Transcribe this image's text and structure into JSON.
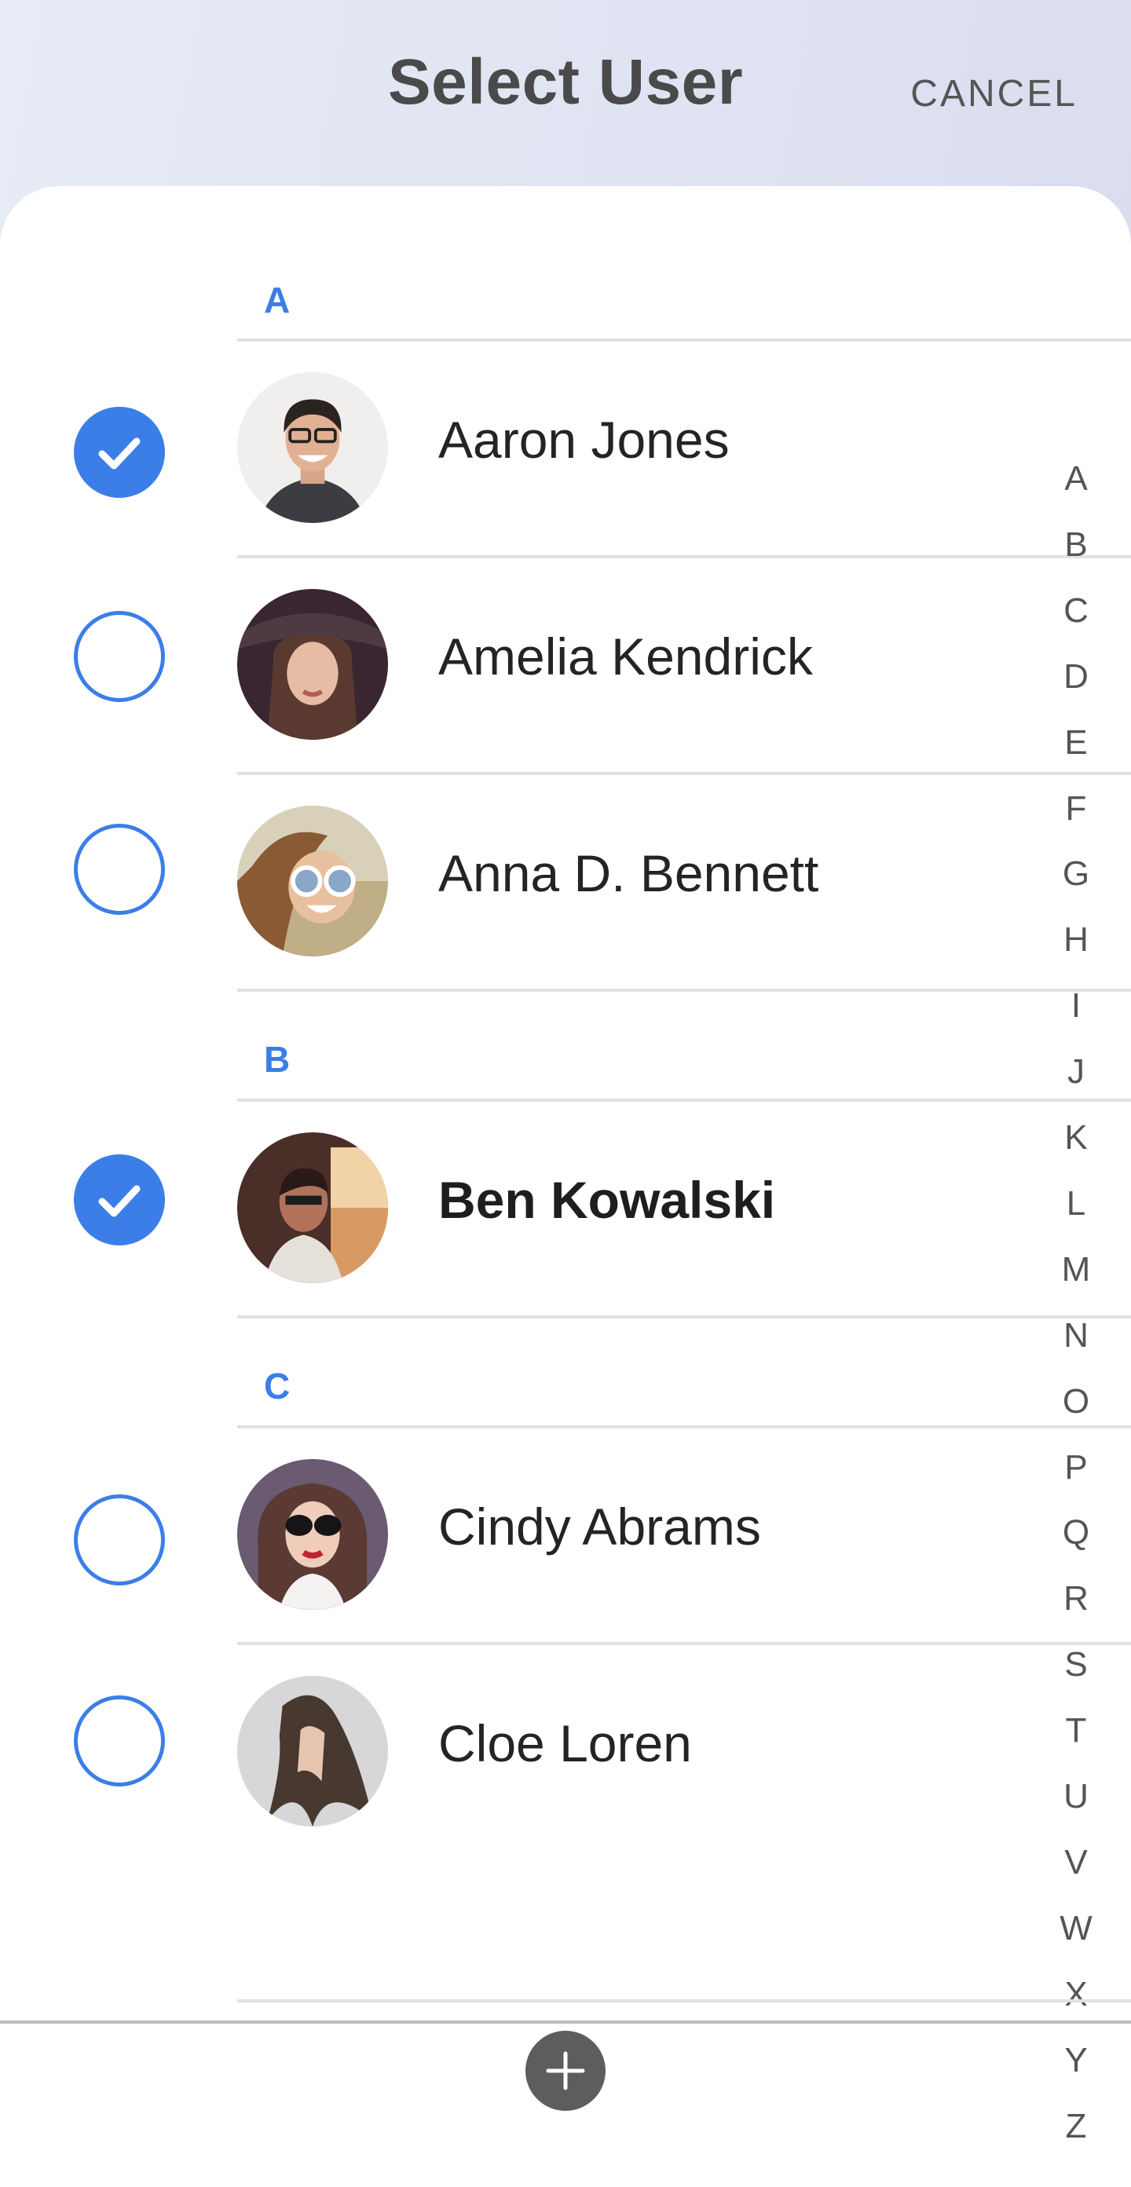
{
  "header": {
    "title": "Select User",
    "cancel_label": "CANCEL"
  },
  "sections": [
    {
      "letter": "A"
    },
    {
      "letter": "B"
    },
    {
      "letter": "C"
    }
  ],
  "users": [
    {
      "name": "Aaron   Jones",
      "selected": true
    },
    {
      "name": "Amelia   Kendrick",
      "selected": false
    },
    {
      "name": "Anna  D. Bennett",
      "selected": false
    },
    {
      "name": "Ben  Kowalski",
      "selected": true
    },
    {
      "name": "Cindy Abrams",
      "selected": false
    },
    {
      "name": "Cloe Loren",
      "selected": false
    }
  ],
  "index_letters": [
    "A",
    "B",
    "C",
    "D",
    "E",
    "F",
    "G",
    "H",
    "I",
    "J",
    "K",
    "L",
    "M",
    "N",
    "O",
    "P",
    "Q",
    "R",
    "S",
    "T",
    "U",
    "V",
    "W",
    "X",
    "Y",
    "Z"
  ],
  "colors": {
    "accent": "#3b7ee8",
    "add_button": "#5d5d5d"
  },
  "icons": {
    "selected": "check-icon",
    "add": "plus-icon"
  }
}
